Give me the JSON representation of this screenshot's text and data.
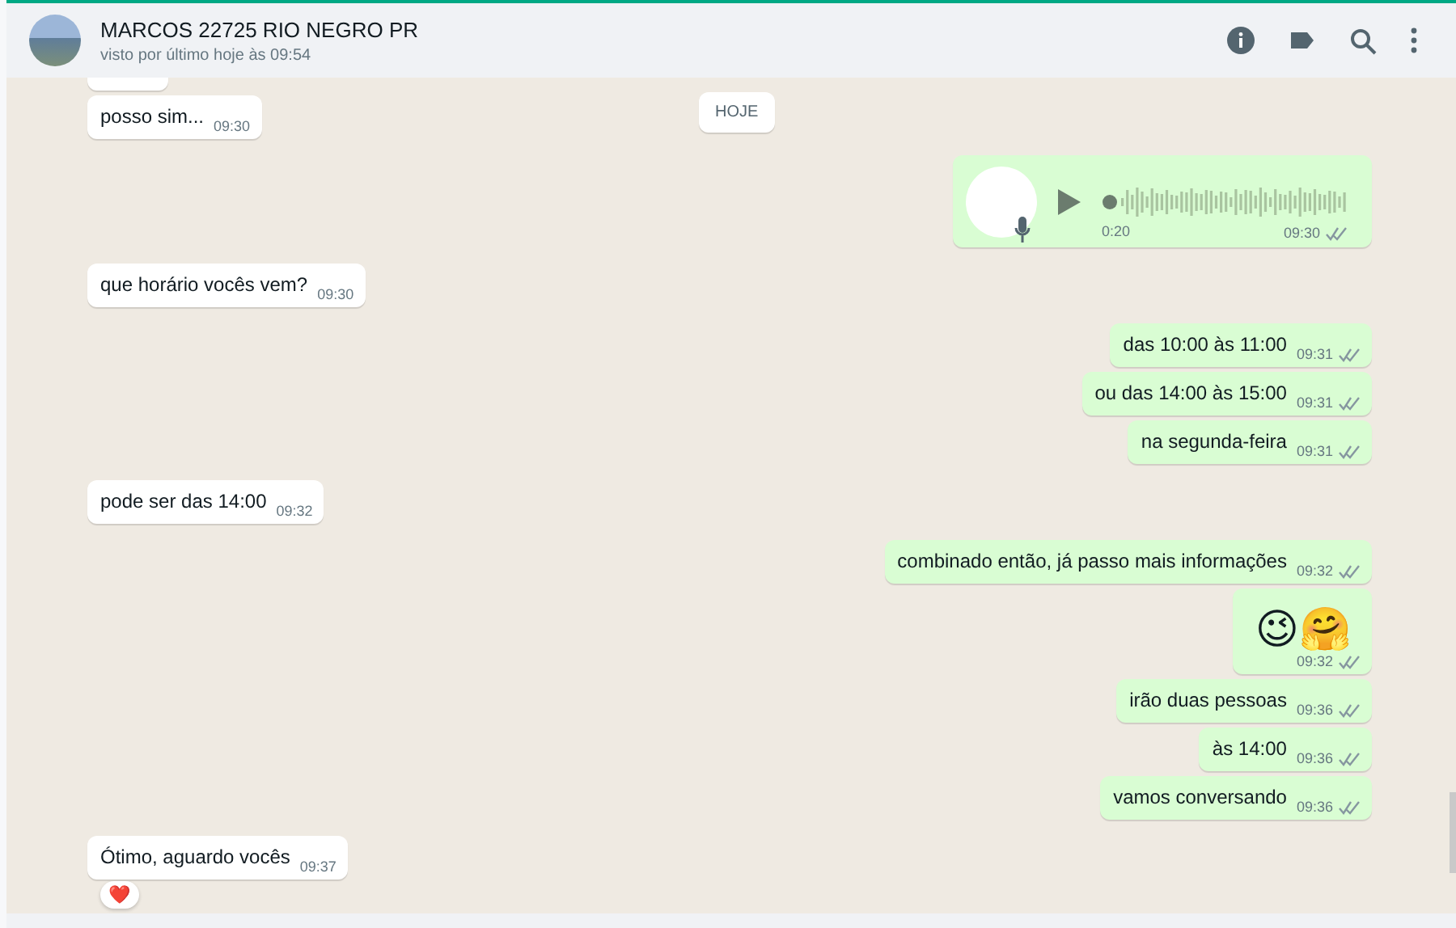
{
  "header": {
    "contact_name": "MARCOS 22725 RIO NEGRO PR",
    "last_seen": "visto por último hoje às 09:54"
  },
  "date_chip": "HOJE",
  "messages": [
    {
      "kind": "text",
      "sent": false
    },
    {
      "kind": "text",
      "sent": false,
      "text": "posso sim...",
      "time": "09:30"
    },
    {
      "kind": "audio",
      "sent": true,
      "duration": "0:20",
      "time": "09:30",
      "read": false
    },
    {
      "kind": "text",
      "sent": false,
      "text": "que horário vocês vem?",
      "time": "09:30"
    },
    {
      "kind": "text",
      "sent": true,
      "text": "das 10:00 às 11:00",
      "time": "09:31",
      "read": false
    },
    {
      "kind": "text",
      "sent": true,
      "text": "ou das 14:00 às 15:00",
      "time": "09:31",
      "read": false
    },
    {
      "kind": "text",
      "sent": true,
      "text": "na segunda-feira",
      "time": "09:31",
      "read": false
    },
    {
      "kind": "text",
      "sent": false,
      "text": "pode ser das 14:00",
      "time": "09:32"
    },
    {
      "kind": "text",
      "sent": true,
      "text": "combinado então, já passo mais informações",
      "time": "09:32",
      "read": false
    },
    {
      "kind": "emoji",
      "sent": true,
      "text": "😉🤗",
      "time": "09:32",
      "read": false
    },
    {
      "kind": "text",
      "sent": true,
      "text": "irão duas pessoas",
      "time": "09:36",
      "read": false
    },
    {
      "kind": "text",
      "sent": true,
      "text": "às 14:00",
      "time": "09:36",
      "read": false
    },
    {
      "kind": "text",
      "sent": true,
      "text": "vamos conversando",
      "time": "09:36",
      "read": false
    },
    {
      "kind": "text",
      "sent": false,
      "text": "Ótimo, aguardo vocês",
      "time": "09:37",
      "reaction": "❤️"
    }
  ]
}
